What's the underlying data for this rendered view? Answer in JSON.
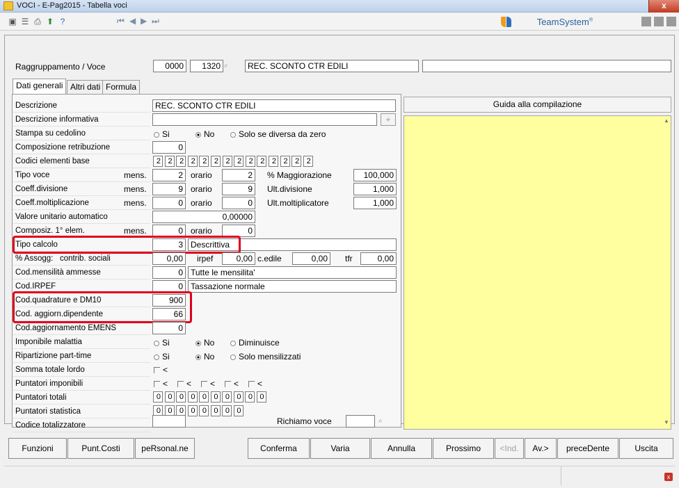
{
  "window": {
    "title": "VOCI - E-Pag2015  -  Tabella voci",
    "close_glyph": "x"
  },
  "toolbar": {
    "brand": "TeamSystem",
    "brand_reg": "®"
  },
  "header": {
    "label": "Raggruppamento / Voce",
    "group_code": "0000",
    "voice_code": "1320",
    "voice_name": "REC. SCONTO CTR EDILI",
    "extra": ""
  },
  "tabs": [
    {
      "label": "Dati generali"
    },
    {
      "label": "Altri dati"
    },
    {
      "label": "Formula"
    }
  ],
  "guide": {
    "title": "Guida alla compilazione"
  },
  "form": {
    "descrizione": {
      "label": "Descrizione",
      "value": "REC. SCONTO CTR EDILI"
    },
    "descr_info": {
      "label": "Descrizione informativa",
      "value": ""
    },
    "stampa": {
      "label": "Stampa su cedolino",
      "opt1": "Si",
      "opt2": "No",
      "opt3": "Solo se diversa da zero"
    },
    "composizione": {
      "label": "Composizione retribuzione",
      "value": "0"
    },
    "codici_base": {
      "label": "Codici elementi base",
      "values": [
        "2",
        "2",
        "2",
        "2",
        "2",
        "2",
        "2",
        "2",
        "2",
        "2",
        "2",
        "2",
        "2",
        "2"
      ]
    },
    "tipo_voce": {
      "label": "Tipo voce",
      "mens_label": "mens.",
      "mens": "2",
      "orario_label": "orario",
      "orario": "2",
      "pct_label": "% Maggiorazione",
      "pct": "100,000"
    },
    "coeff_div": {
      "label": "Coeff.divisione",
      "mens_label": "mens.",
      "mens": "9",
      "orario_label": "orario",
      "orario": "9",
      "ult_label": "Ult.divisione",
      "ult": "1,000"
    },
    "coeff_molt": {
      "label": "Coeff.moltiplicazione",
      "mens_label": "mens.",
      "mens": "0",
      "orario_label": "orario",
      "orario": "0",
      "ult_label": "Ult.moltiplicatore",
      "ult": "1,000"
    },
    "valore_unit": {
      "label": "Valore unitario automatico",
      "value": "0,00000"
    },
    "composiz_elem": {
      "label": "Composiz. 1° elem.",
      "mens_label": "mens.",
      "mens": "0",
      "orario_label": "orario",
      "orario": "0"
    },
    "tipo_calcolo": {
      "label": "Tipo calcolo",
      "code": "3",
      "desc": "Descrittiva"
    },
    "assogg": {
      "label": "% Assogg:",
      "sub_label": "contrib. sociali",
      "contrib": "0,00",
      "irpef_label": "irpef",
      "irpef": "0,00",
      "cedile_label": "c.edile",
      "cedile": "0,00",
      "tfr_label": "tfr",
      "tfr": "0,00"
    },
    "mensilita": {
      "label": "Cod.mensilità ammesse",
      "code": "0",
      "desc": "Tutte le mensilita'"
    },
    "irpef": {
      "label": "Cod.IRPEF",
      "code": "0",
      "desc": "Tassazione normale"
    },
    "quadrature": {
      "label": "Cod.quadrature e DM10",
      "value": "900"
    },
    "aggiorn_dip": {
      "label": "Cod. aggiorn.dipendente",
      "value": "66"
    },
    "emens": {
      "label": "Cod.aggiornamento EMENS",
      "value": "0"
    },
    "malattia": {
      "label": "Imponibile malattia",
      "opt1": "Si",
      "opt2": "No",
      "opt3": "Diminuisce"
    },
    "part_time": {
      "label": "Ripartizione part-time",
      "opt1": "Si",
      "opt2": "No",
      "opt3": "Solo mensilizzati"
    },
    "somma_lordo": {
      "label": "Somma totale lordo",
      "mark": "<"
    },
    "punt_imponibili": {
      "label": "Puntatori imponibili",
      "marks": [
        "<",
        "<",
        "<",
        "<",
        "<"
      ]
    },
    "punt_totali": {
      "label": "Puntatori totali",
      "values": [
        "0",
        "0",
        "0",
        "0",
        "0",
        "0",
        "0",
        "0",
        "0",
        "0"
      ]
    },
    "punt_statistica": {
      "label": "Puntatori statistica",
      "values": [
        "0",
        "0",
        "0",
        "0",
        "0",
        "0",
        "0",
        "0"
      ]
    },
    "codice_tot": {
      "label": "Codice totalizzatore",
      "value": "",
      "richiamo_label": "Richiamo voce",
      "richiamo": ""
    }
  },
  "buttons": {
    "funzioni": "Funzioni",
    "punt_costi": "Punt.Costi",
    "personal": "peRsonal.ne",
    "conferma": "Conferma",
    "varia": "Varia",
    "annulla": "Annulla",
    "prossimo": "Prossimo",
    "ind": "<Ind.",
    "av": "Av.>",
    "precedente": "preceDente",
    "uscita": "Uscita"
  }
}
